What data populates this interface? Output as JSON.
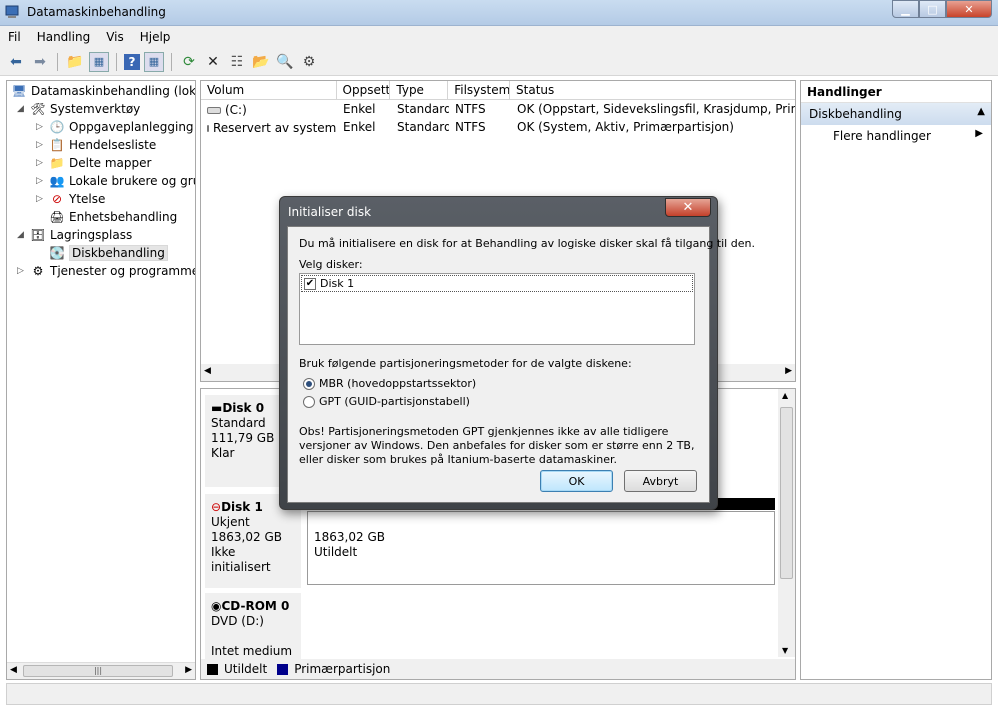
{
  "window": {
    "title": "Datamaskinbehandling"
  },
  "menu": [
    "Fil",
    "Handling",
    "Vis",
    "Hjelp"
  ],
  "toolbar": {
    "icons": [
      "back-icon",
      "forward-icon",
      "up-icon",
      "show-hide-tree-icon",
      "help-icon",
      "show-hide-action-icon",
      "refresh-icon",
      "delete-icon",
      "properties-icon",
      "open-icon",
      "search-icon",
      "settings-icon"
    ]
  },
  "tree": {
    "root": "Datamaskinbehandling (lokal)",
    "systemverktoy": "Systemverktøy",
    "oppgaveplanlegging": "Oppgaveplanlegging",
    "hendelsesliste": "Hendelsesliste",
    "delte_mapper": "Delte mapper",
    "lokale_brukere": "Lokale brukere og grupper",
    "ytelse": "Ytelse",
    "enhetsbehandling": "Enhetsbehandling",
    "lagringsplass": "Lagringsplass",
    "diskbehandling": "Diskbehandling",
    "tjenester": "Tjenester og programmer"
  },
  "volumes": {
    "columns": [
      "Volum",
      "Oppsett",
      "Type",
      "Filsystem",
      "Status"
    ],
    "rows": [
      {
        "volum": "(C:)",
        "oppsett": "Enkel",
        "type": "Standard",
        "filsystem": "NTFS",
        "status": "OK (Oppstart, Sidevekslingsfil, Krasjdump, Primærpartisjon)"
      },
      {
        "volum": "Reservert av systemet",
        "oppsett": "Enkel",
        "type": "Standard",
        "filsystem": "NTFS",
        "status": "OK (System, Aktiv, Primærpartisjon)"
      }
    ]
  },
  "disks": {
    "disk0": {
      "name": "Disk 0",
      "type": "Standard",
      "size": "111,79 GB",
      "state": "Klar"
    },
    "disk1": {
      "name": "Disk 1",
      "type": "Ukjent",
      "size": "1863,02 GB",
      "state": "Ikke initialisert",
      "part_size": "1863,02 GB",
      "part_state": "Utildelt"
    },
    "cdrom": {
      "name": "CD-ROM 0",
      "drive": "DVD (D:)",
      "state": "Intet medium"
    }
  },
  "legend": {
    "unallocated": "Utildelt",
    "primary": "Primærpartisjon",
    "unallocated_color": "#000000",
    "primary_color": "#00008b"
  },
  "actions": {
    "header": "Handlinger",
    "section": "Diskbehandling",
    "more": "Flere handlinger"
  },
  "dialog": {
    "title": "Initialiser disk",
    "intro": "Du må initialisere en disk for at Behandling av logiske disker skal få tilgang til den.",
    "select_label": "Velg disker:",
    "disk_item": "Disk 1",
    "partition_label": "Bruk følgende partisjoneringsmetoder for de valgte diskene:",
    "mbr": "MBR (hovedoppstartssektor)",
    "gpt": "GPT (GUID-partisjonstabell)",
    "note": "Obs! Partisjoneringsmetoden GPT gjenkjennes ikke av alle tidligere versjoner av Windows. Den anbefales for disker som er større enn 2 TB, eller disker som brukes på Itanium-baserte datamaskiner.",
    "ok": "OK",
    "cancel": "Avbryt"
  }
}
